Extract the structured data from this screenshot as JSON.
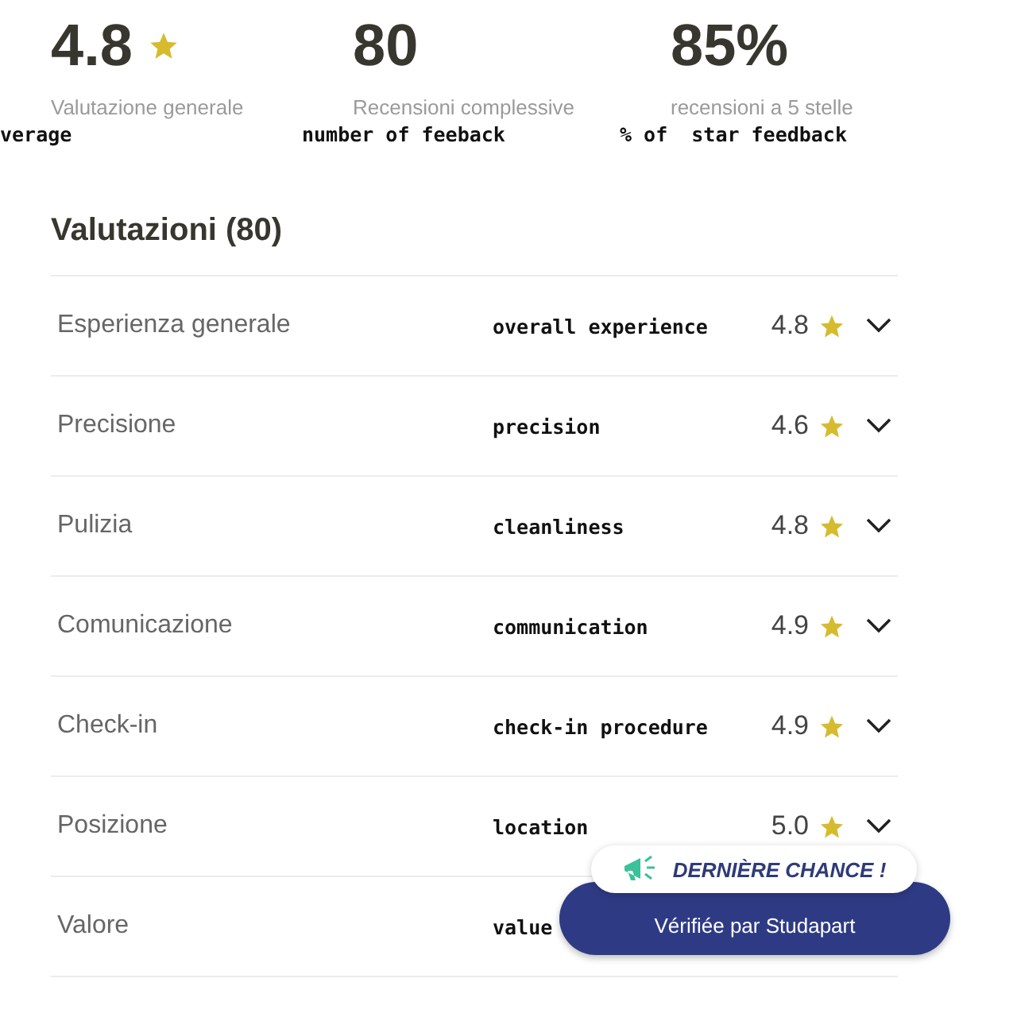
{
  "stats": [
    {
      "value": "4.8",
      "has_star": true,
      "label": "Valutazione generale",
      "note": "verage"
    },
    {
      "value": "80",
      "has_star": false,
      "label": "Recensioni complessive",
      "note": "number of feeback"
    },
    {
      "value": "85%",
      "has_star": false,
      "label": "recensioni a 5 stelle",
      "note": "% of  star feedback"
    }
  ],
  "heading": "Valutazioni (80)",
  "ratings": [
    {
      "label": "Esperienza generale",
      "note": "overall experience",
      "score": "4.8",
      "expanded": false
    },
    {
      "label": "Precisione",
      "note": "precision",
      "score": "4.6",
      "expanded": false
    },
    {
      "label": "Pulizia",
      "note": "cleanliness",
      "score": "4.8",
      "expanded": false
    },
    {
      "label": "Comunicazione",
      "note": "communication",
      "score": "4.9",
      "expanded": false
    },
    {
      "label": "Check-in",
      "note": "check-in procedure",
      "score": "4.9",
      "expanded": false
    },
    {
      "label": "Posizione",
      "note": "location",
      "score": "5.0",
      "expanded": false
    },
    {
      "label": "Valore",
      "note": "value"
    }
  ],
  "badge": "DERNIÈRE CHANCE !",
  "verified_button": "Vérifiée par Studapart"
}
